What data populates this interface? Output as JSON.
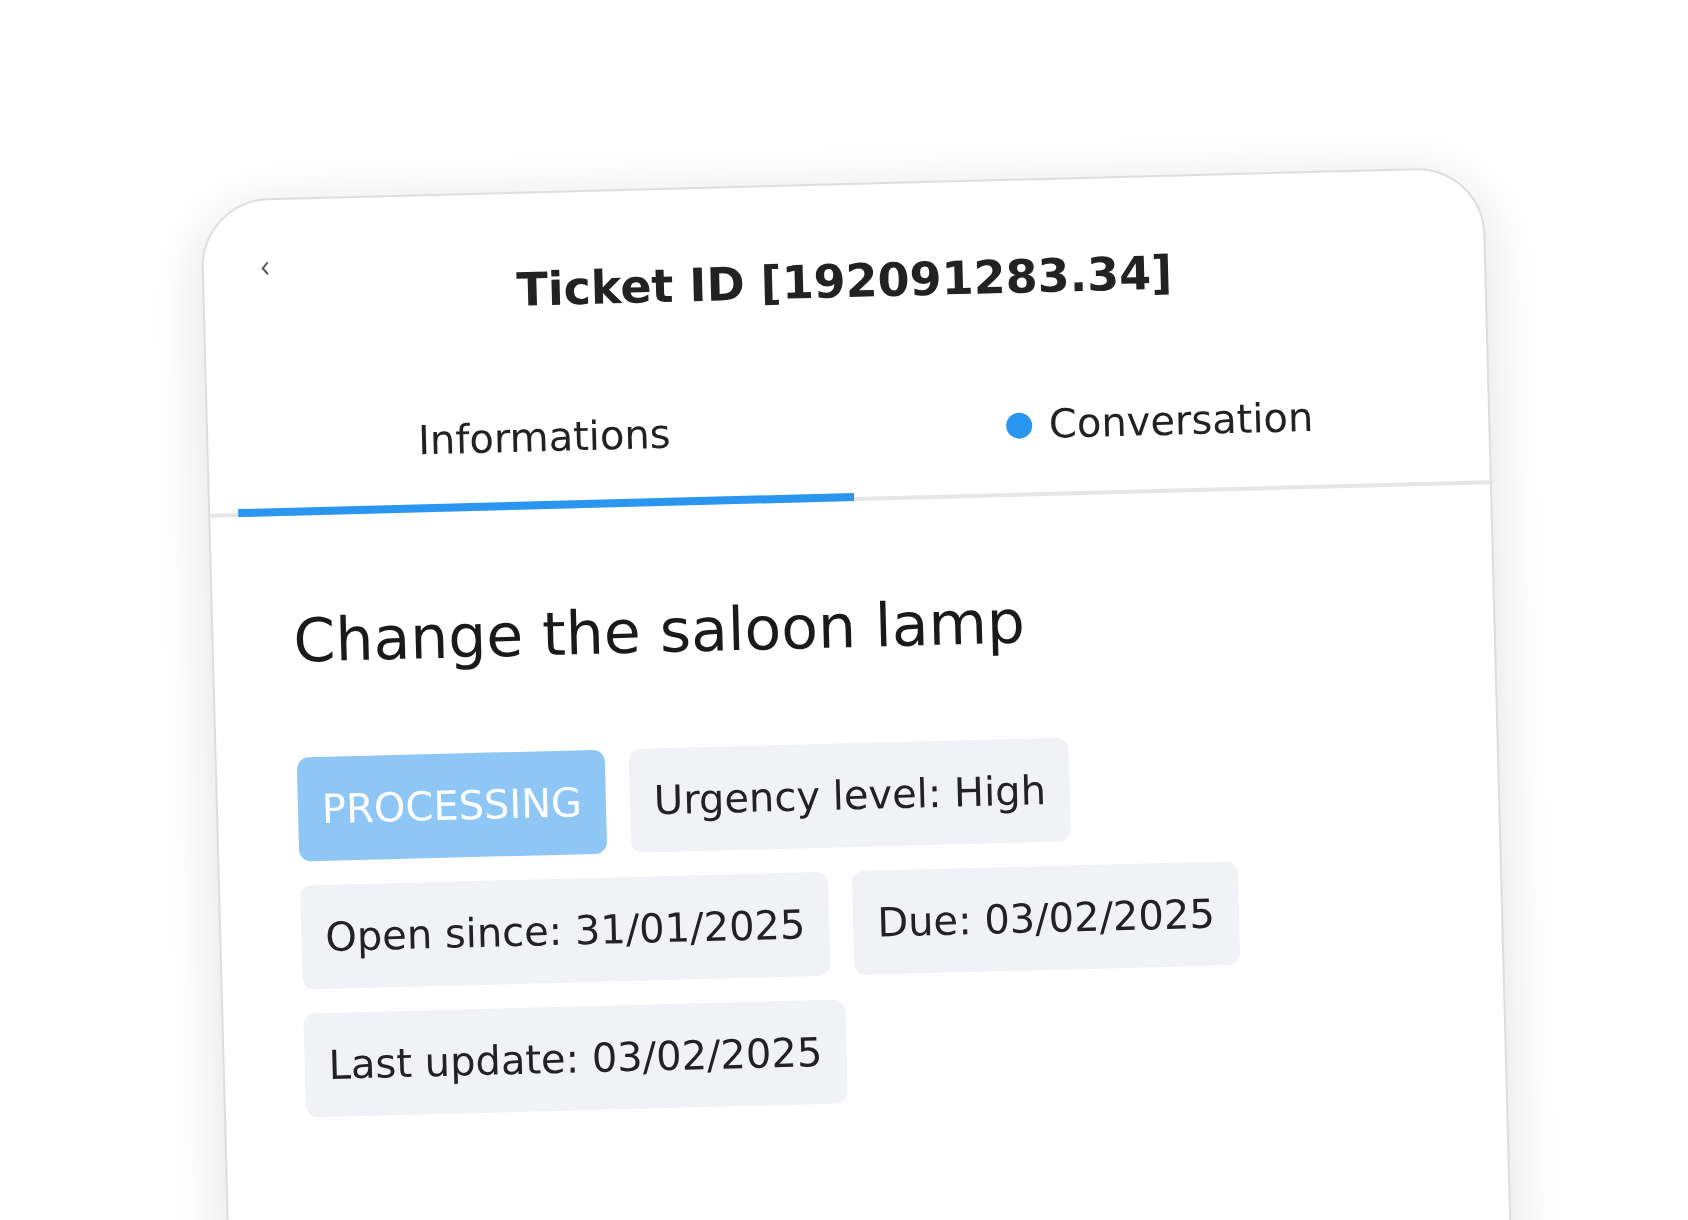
{
  "header": {
    "title": "Ticket ID [192091283.34]"
  },
  "tabs": [
    {
      "label": "Informations",
      "selected": true,
      "unread": false
    },
    {
      "label": "Conversation",
      "selected": false,
      "unread": true
    }
  ],
  "ticket": {
    "title": "Change the saloon lamp",
    "tags": [
      {
        "kind": "status",
        "label": "PROCESSING"
      },
      {
        "kind": "info",
        "label": "Urgency level: High"
      },
      {
        "kind": "info",
        "label": "Open since: 31/01/2025"
      },
      {
        "kind": "info",
        "label": "Due: 03/02/2025"
      },
      {
        "kind": "info",
        "label": "Last update: 03/02/2025"
      }
    ]
  }
}
